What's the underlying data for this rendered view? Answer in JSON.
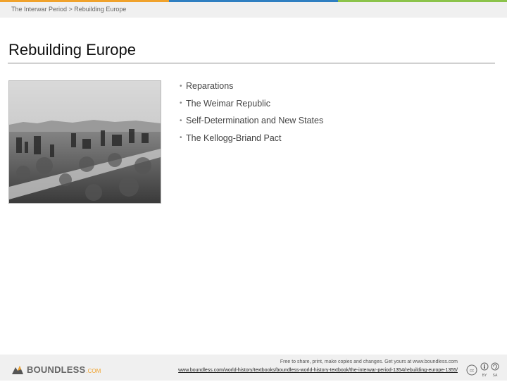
{
  "colors": {
    "accent_bar": [
      "#f0a22c",
      "#2f7fc1",
      "#8bc34a"
    ],
    "background": "#ffffff",
    "band": "#f0f0f0",
    "logo_accent": "#f0a22c"
  },
  "breadcrumb": "The Interwar Period > Rebuilding Europe",
  "title": "Rebuilding Europe",
  "image": {
    "icon": "war-ruins-photo"
  },
  "bullets": [
    "Reparations",
    "The Weimar Republic",
    "Self-Determination and New States",
    "The Kellogg-Briand Pact"
  ],
  "footer": {
    "logo_name": "BOUNDLESS",
    "logo_domain": ".COM",
    "license_text": "Free to share, print, make copies and changes. Get yours at www.boundless.com",
    "source_url": "www.boundless.com/world-history/textbooks/boundless-world-history-textbook/the-interwar-period-1354/rebuilding-europe-1355/",
    "cc_icons": [
      "cc-icon",
      "by-icon",
      "sa-icon"
    ],
    "cc_labels": [
      "BY",
      "SA"
    ]
  }
}
